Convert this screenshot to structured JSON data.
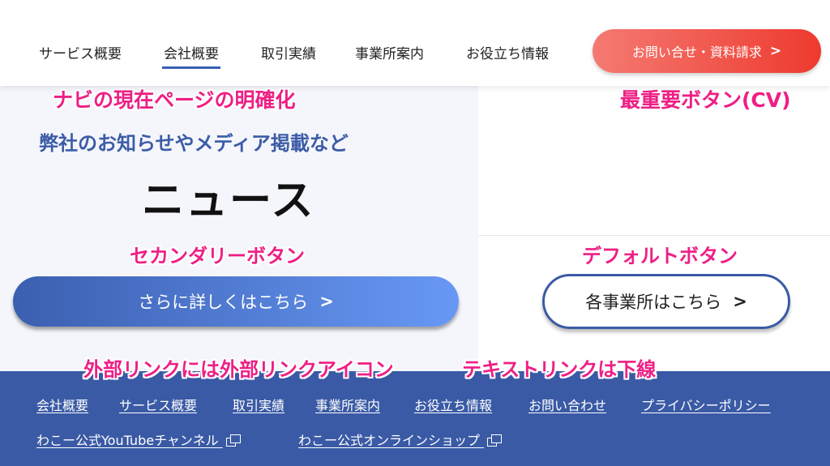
{
  "header": {
    "nav": [
      {
        "label": "サービス概要"
      },
      {
        "label": "会社概要"
      },
      {
        "label": "取引実績"
      },
      {
        "label": "事業所案内"
      },
      {
        "label": "お役立ち情報"
      }
    ],
    "active_index": 1,
    "cv_button": {
      "label": "お問い合せ・資料請求",
      "chevron": ">"
    }
  },
  "annotations": {
    "nav_current": "ナビの現在ページの明確化",
    "cv": "最重要ボタン(CV)",
    "secondary": "セカンダリーボタン",
    "default": "デフォルトボタン",
    "external": "外部リンクには外部リンクアイコン",
    "text_link": "テキストリンクは下線"
  },
  "section": {
    "kicker": "弊社のお知らせやメディア掲載など",
    "title": "ニュース",
    "secondary_button": {
      "label": "さらに詳しくはこちら",
      "chevron": ">"
    },
    "default_button": {
      "label": "各事業所はこちら",
      "chevron": ">"
    }
  },
  "footer": {
    "links": [
      {
        "label": "会社概要"
      },
      {
        "label": "サービス概要"
      },
      {
        "label": "取引実績"
      },
      {
        "label": "事業所案内"
      },
      {
        "label": "お役立ち情報"
      },
      {
        "label": "お問い合わせ"
      },
      {
        "label": "プライバシーポリシー"
      }
    ],
    "external_links": [
      {
        "label": "わこー公式YouTubeチャンネル",
        "icon": "external-link-icon"
      },
      {
        "label": "わこー公式オンラインショップ",
        "icon": "external-link-icon"
      }
    ]
  },
  "colors": {
    "brand_blue": "#3a5aa5",
    "cv_red": "#ee3a2f",
    "annotation_pink": "#ee1f85"
  }
}
